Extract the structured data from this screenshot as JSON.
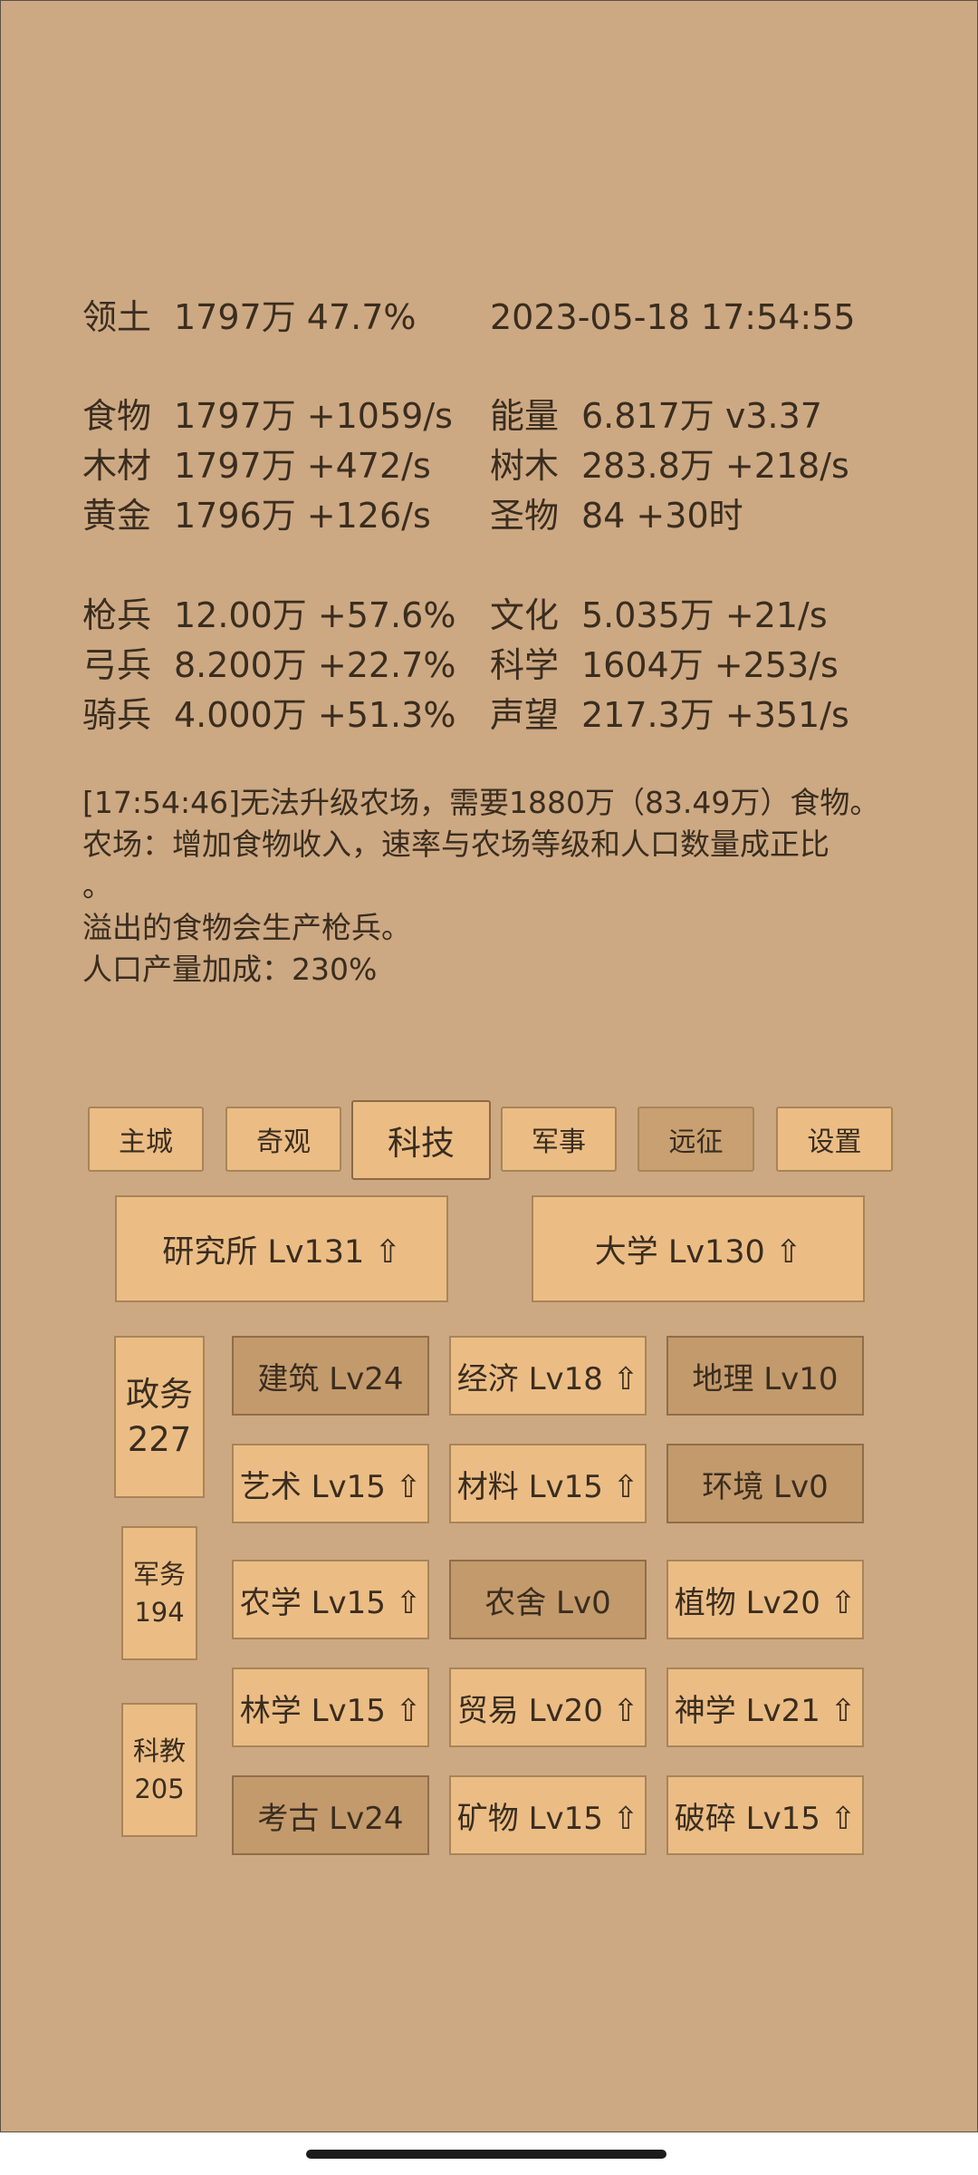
{
  "header": {
    "territory_label": "领土",
    "territory_value": "1797万  47.7%",
    "datetime": "2023-05-18 17:54:55"
  },
  "resources": [
    {
      "label": "食物",
      "value": "1797万 +1059/s"
    },
    {
      "label": "能量",
      "value": "6.817万  v3.37"
    },
    {
      "label": "木材",
      "value": "1797万 +472/s"
    },
    {
      "label": "树木",
      "value": "283.8万 +218/s"
    },
    {
      "label": "黄金",
      "value": "1796万 +126/s"
    },
    {
      "label": "圣物",
      "value": "84 +30时"
    }
  ],
  "military": [
    {
      "label": "枪兵",
      "value": "12.00万 +57.6%"
    },
    {
      "label": "文化",
      "value": "5.035万 +21/s"
    },
    {
      "label": "弓兵",
      "value": "8.200万 +22.7%"
    },
    {
      "label": "科学",
      "value": "1604万 +253/s"
    },
    {
      "label": "骑兵",
      "value": "4.000万 +51.3%"
    },
    {
      "label": "声望",
      "value": "217.3万 +351/s"
    }
  ],
  "message": {
    "line1": "[17:54:46]无法升级农场，需要1880万（83.49万）食物。",
    "line2": "农场：增加食物收入，速率与农场等级和人口数量成正比",
    "line3": "。",
    "line4": "溢出的食物会生产枪兵。",
    "line5": "人口产量加成：230%"
  },
  "tabs": [
    {
      "label": "主城"
    },
    {
      "label": "奇观"
    },
    {
      "label": "科技"
    },
    {
      "label": "军事"
    },
    {
      "label": "远征"
    },
    {
      "label": "设置"
    }
  ],
  "buildings": [
    {
      "label": "研究所 Lv131 ⇧"
    },
    {
      "label": "大学 Lv130 ⇧"
    }
  ],
  "categories": [
    {
      "name": "政务",
      "count": "227"
    },
    {
      "name": "军务",
      "count": "194"
    },
    {
      "name": "科教",
      "count": "205"
    }
  ],
  "techs": [
    {
      "label": "建筑 Lv24"
    },
    {
      "label": "经济 Lv18 ⇧"
    },
    {
      "label": "地理 Lv10"
    },
    {
      "label": "艺术 Lv15 ⇧"
    },
    {
      "label": "材料 Lv15 ⇧"
    },
    {
      "label": "环境 Lv0"
    },
    {
      "label": "农学 Lv15 ⇧"
    },
    {
      "label": "农舍 Lv0"
    },
    {
      "label": "植物 Lv20 ⇧"
    },
    {
      "label": "林学 Lv15 ⇧"
    },
    {
      "label": "贸易 Lv20 ⇧"
    },
    {
      "label": "神学 Lv21 ⇧"
    },
    {
      "label": "考古 Lv24"
    },
    {
      "label": "矿物 Lv15 ⇧"
    },
    {
      "label": "破碎 Lv15 ⇧"
    }
  ],
  "colors": {
    "background": "#cca983",
    "button": "#ebbd85",
    "button_locked": "#c39a6c",
    "text": "#3a2d1f"
  }
}
